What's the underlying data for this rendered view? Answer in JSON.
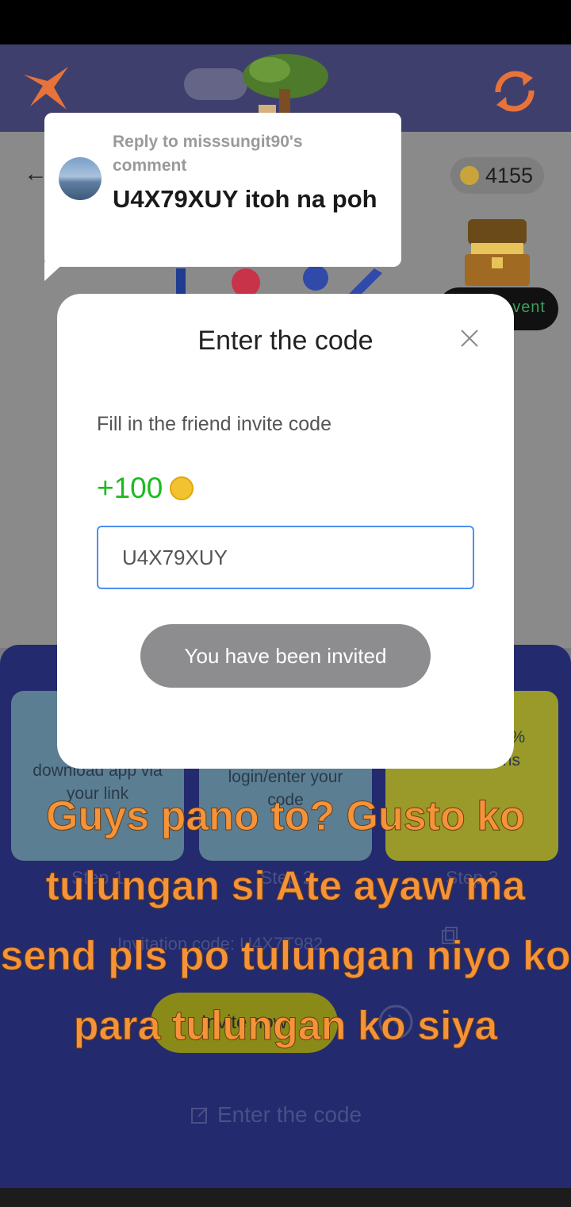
{
  "app": {
    "coin_balance": "4155",
    "event_badge": "vent"
  },
  "reply": {
    "label": "Reply to misssungit90's comment",
    "text": "U4X79XUY itoh na poh"
  },
  "modal": {
    "title": "Enter the code",
    "subtitle": "Fill in the friend invite code",
    "reward": "+100",
    "input_value": "U4X79XUY",
    "submit_label": "You have been invited"
  },
  "steps": [
    {
      "text": "download app via your link",
      "label": "Step 1"
    },
    {
      "text": "login/enter your code",
      "label": "Step 2"
    },
    {
      "text": "ay ou get 35% friends' coins",
      "label": "Step 3"
    }
  ],
  "invite": {
    "code_row": "Invitation code: U4X7T982",
    "invite_button": "Invite now",
    "enter_code_link": "Enter the code"
  },
  "overlay_caption": "Guys pano to? Gusto ko tulungan si Ate ayaw ma send pls po tulungan niyo ko para tulungan ko siya",
  "colors": {
    "accent_blue": "#4f8ff0",
    "reward_green": "#1dbb1d",
    "caption_orange": "#f5933a",
    "panel_navy": "#232a6e"
  }
}
